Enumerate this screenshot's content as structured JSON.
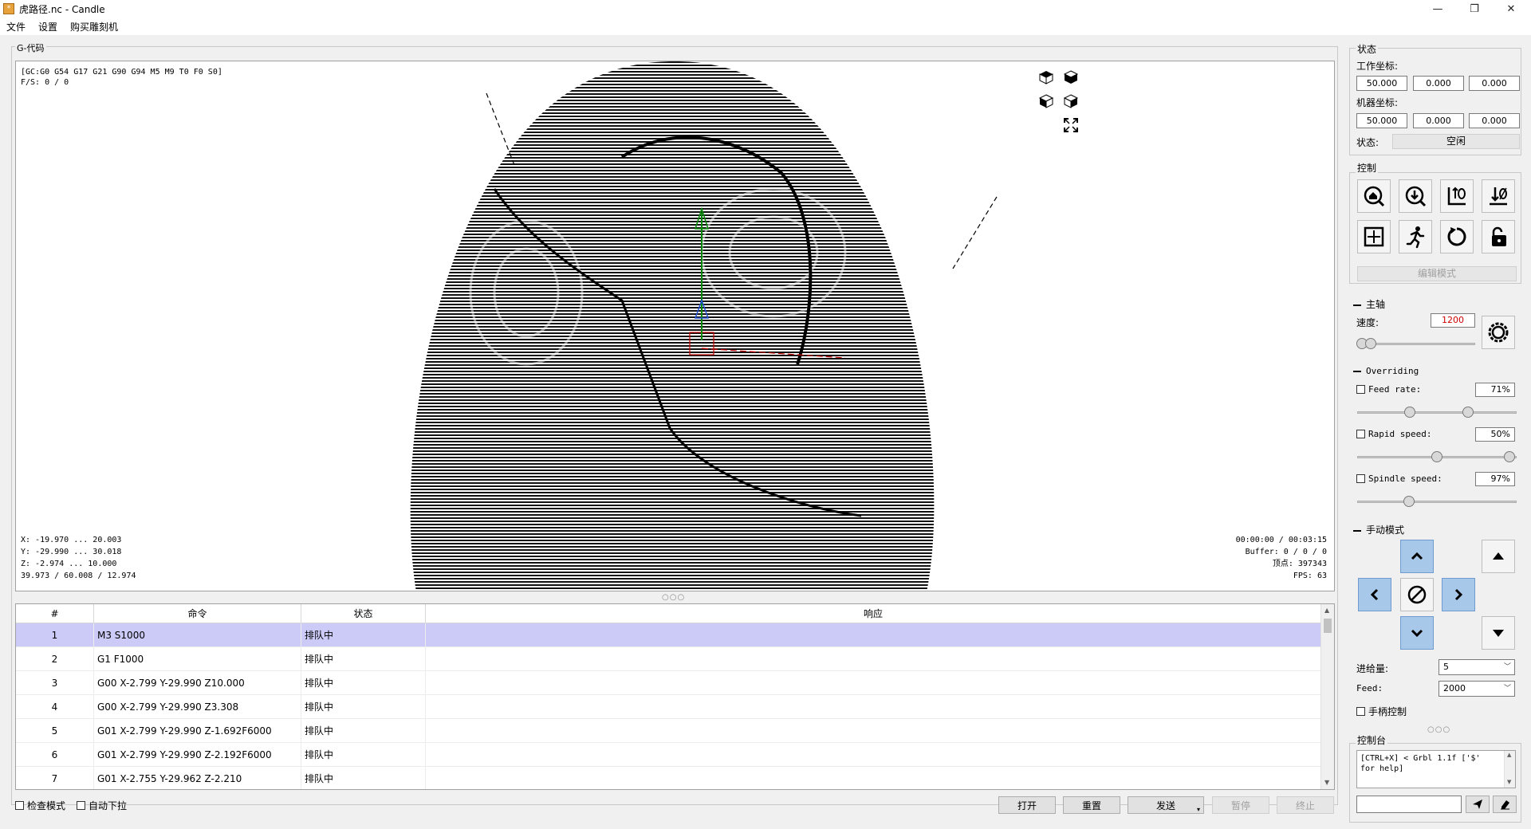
{
  "window": {
    "title": "虎路径.nc - Candle",
    "app_icon": "candle-app-icon",
    "minimize": "—",
    "restore": "❐",
    "close": "✕"
  },
  "menu": [
    "文件",
    "设置",
    "购买雕刻机"
  ],
  "gcode": {
    "group_title": "G-代码",
    "status_lines": [
      "[GC:G0 G54 G17 G21 G90 G94 M5 M9 T0 F0 S0]",
      "F/S: 0 / 0"
    ],
    "bounds_lines": [
      "X: -19.970 ... 20.003",
      "Y: -29.990 ... 30.018",
      "Z: -2.974 ... 10.000",
      "39.973 / 60.008 / 12.974"
    ],
    "info_lines": [
      "00:00:00 / 00:03:15",
      "Buffer: 0 / 0 / 0",
      "顶点: 397343",
      "FPS: 63"
    ]
  },
  "table": {
    "headers": [
      "#",
      "命令",
      "状态",
      "响应"
    ],
    "rows": [
      {
        "num": "1",
        "command": "M3 S1000",
        "state": "排队中",
        "response": ""
      },
      {
        "num": "2",
        "command": "G1 F1000",
        "state": "排队中",
        "response": ""
      },
      {
        "num": "3",
        "command": "G00 X-2.799 Y-29.990 Z10.000",
        "state": "排队中",
        "response": ""
      },
      {
        "num": "4",
        "command": "G00 X-2.799 Y-29.990 Z3.308",
        "state": "排队中",
        "response": ""
      },
      {
        "num": "5",
        "command": "G01 X-2.799 Y-29.990 Z-1.692F6000",
        "state": "排队中",
        "response": ""
      },
      {
        "num": "6",
        "command": "G01 X-2.799 Y-29.990 Z-2.192F6000",
        "state": "排队中",
        "response": ""
      },
      {
        "num": "7",
        "command": "G01 X-2.755 Y-29.962 Z-2.210",
        "state": "排队中",
        "response": ""
      }
    ]
  },
  "bottom": {
    "check_mode": "检查模式",
    "auto_scroll": "自动下拉",
    "open": "打开",
    "reset": "重置",
    "send": "发送",
    "pause": "暂停",
    "abort": "终止"
  },
  "status_panel": {
    "title": "状态",
    "work_coords_label": "工作坐标:",
    "work_coords": [
      "50.000",
      "0.000",
      "0.000"
    ],
    "machine_coords_label": "机器坐标:",
    "machine_coords": [
      "50.000",
      "0.000",
      "0.000"
    ],
    "state_label": "状态:",
    "state_value": "空闲"
  },
  "control_panel": {
    "title": "控制",
    "edit_mode": "编辑模式"
  },
  "spindle": {
    "title": "主轴",
    "speed_label": "速度:",
    "speed_value": "1200",
    "speed_color": "#cc0000",
    "speed_level": 0.03
  },
  "overriding": {
    "title": "Overriding",
    "feed_label": "Feed rate:",
    "feed_value": "71%",
    "feed_level": 0.71,
    "rapid_label": "Rapid speed:",
    "rapid_value": "50%",
    "rapid_level": 0.5,
    "spindle_label": "Spindle speed:",
    "spindle_value": "97%",
    "spindle_level": 0.97
  },
  "jog": {
    "title": "手动模式",
    "step_label": "进给量:",
    "step_value": "5",
    "feed_label": "Feed:",
    "feed_value": "2000",
    "handwheel": "手柄控制",
    "accent": "#a8c8ea"
  },
  "console": {
    "title": "控制台",
    "text_1": "[CTRL+X] < Grbl 1.1f ['$'",
    "text_2": "for help]"
  }
}
